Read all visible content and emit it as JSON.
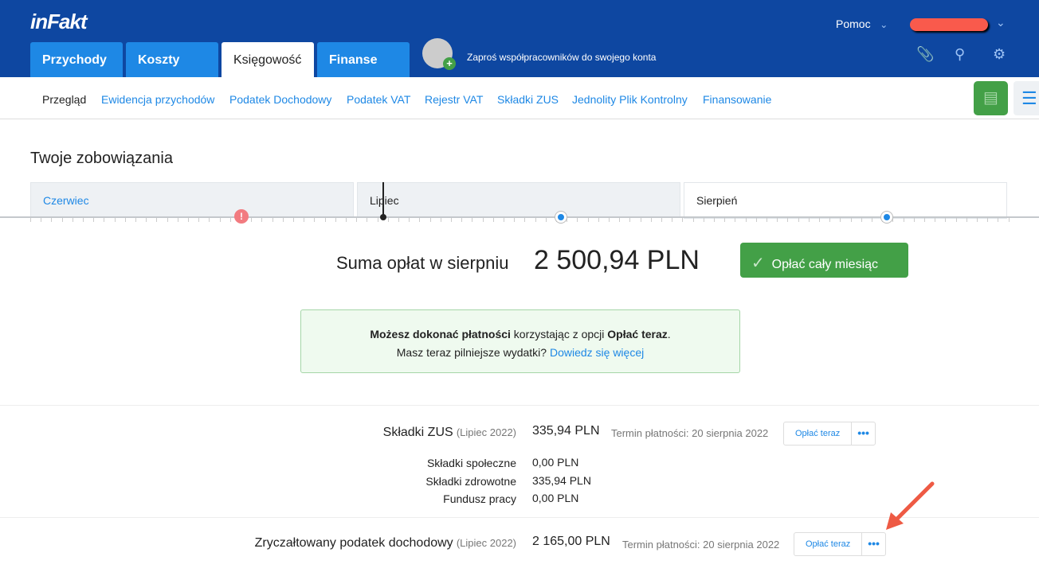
{
  "header": {
    "logo": "inFakt",
    "tabs": [
      "Przychody",
      "Koszty",
      "Księgowość",
      "Finanse"
    ],
    "invite": "Zaproś współpracowników do swojego konta",
    "help": "Pomoc"
  },
  "subnav": [
    "Przegląd",
    "Ewidencja przychodów",
    "Podatek Dochodowy",
    "Podatek VAT",
    "Rejestr VAT",
    "Składki ZUS",
    "Jednolity Plik Kontrolny",
    "Finansowanie"
  ],
  "main": {
    "title": "Twoje zobowiązania",
    "months": [
      "Czerwiec",
      "Lipiec",
      "Sierpień"
    ],
    "sum_label": "Suma opłat w sierpniu",
    "sum_value": "2 500,94 PLN",
    "pay_all": "Opłać cały miesiąc",
    "info": {
      "bold1": "Możesz dokonać płatności",
      "text1": " korzystając z opcji ",
      "bold2": "Opłać teraz",
      "dot": ".",
      "text2": "Masz teraz pilniejsze wydatki? ",
      "link": "Dowiedz się więcej"
    },
    "items": [
      {
        "name": "Składki ZUS",
        "period": "(Lipiec 2022)",
        "amount": "335,94 PLN",
        "due": "Termin płatności: 20 sierpnia 2022",
        "pay": "Opłać teraz",
        "more": "•••",
        "sub": [
          {
            "label": "Składki społeczne",
            "value": "0,00 PLN"
          },
          {
            "label": "Składki zdrowotne",
            "value": "335,94 PLN"
          },
          {
            "label": "Fundusz pracy",
            "value": "0,00 PLN"
          }
        ]
      },
      {
        "name": "Zryczałtowany podatek dochodowy",
        "period": "(Lipiec 2022)",
        "amount": "2 165,00 PLN",
        "due": "Termin płatności: 20 sierpnia 2022",
        "pay": "Opłać teraz",
        "more": "•••"
      }
    ]
  }
}
